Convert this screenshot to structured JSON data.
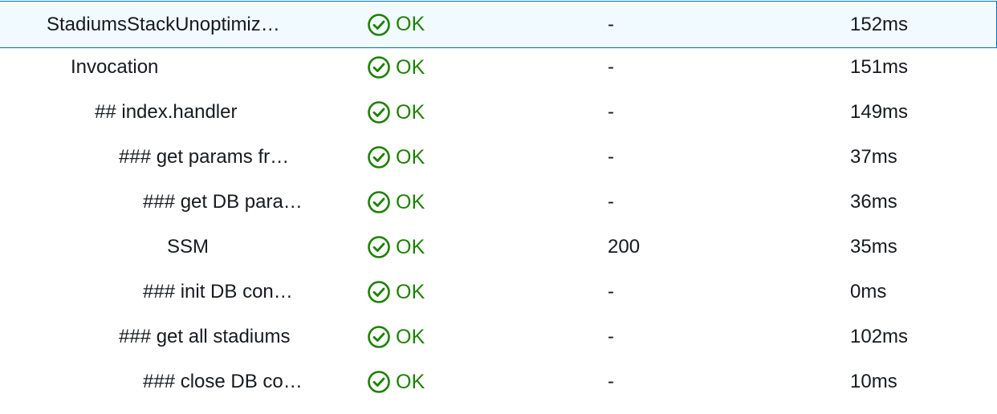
{
  "rows": [
    {
      "name": "StadiumsStackUnoptimiz…",
      "status": "OK",
      "response": "-",
      "duration": "152ms",
      "indent": 0,
      "selected": true
    },
    {
      "name": "Invocation",
      "status": "OK",
      "response": "-",
      "duration": "151ms",
      "indent": 1,
      "selected": false
    },
    {
      "name": "## index.handler",
      "status": "OK",
      "response": "-",
      "duration": "149ms",
      "indent": 2,
      "selected": false
    },
    {
      "name": "### get params fr…",
      "status": "OK",
      "response": "-",
      "duration": "37ms",
      "indent": 3,
      "selected": false
    },
    {
      "name": "### get DB para…",
      "status": "OK",
      "response": "-",
      "duration": "36ms",
      "indent": 4,
      "selected": false
    },
    {
      "name": "SSM",
      "status": "OK",
      "response": "200",
      "duration": "35ms",
      "indent": 5,
      "selected": false
    },
    {
      "name": "### init DB con…",
      "status": "OK",
      "response": "-",
      "duration": "0ms",
      "indent": 4,
      "selected": false
    },
    {
      "name": "### get all stadiums",
      "status": "OK",
      "response": "-",
      "duration": "102ms",
      "indent": 3,
      "selected": false
    },
    {
      "name": "### close DB co…",
      "status": "OK",
      "response": "-",
      "duration": "10ms",
      "indent": 4,
      "selected": false
    }
  ],
  "status_icon": "check-circle-icon",
  "colors": {
    "ok_green": "#1d8102",
    "selected_border": "#0073bb",
    "selected_bg": "#f1faff",
    "text": "#16191f"
  }
}
